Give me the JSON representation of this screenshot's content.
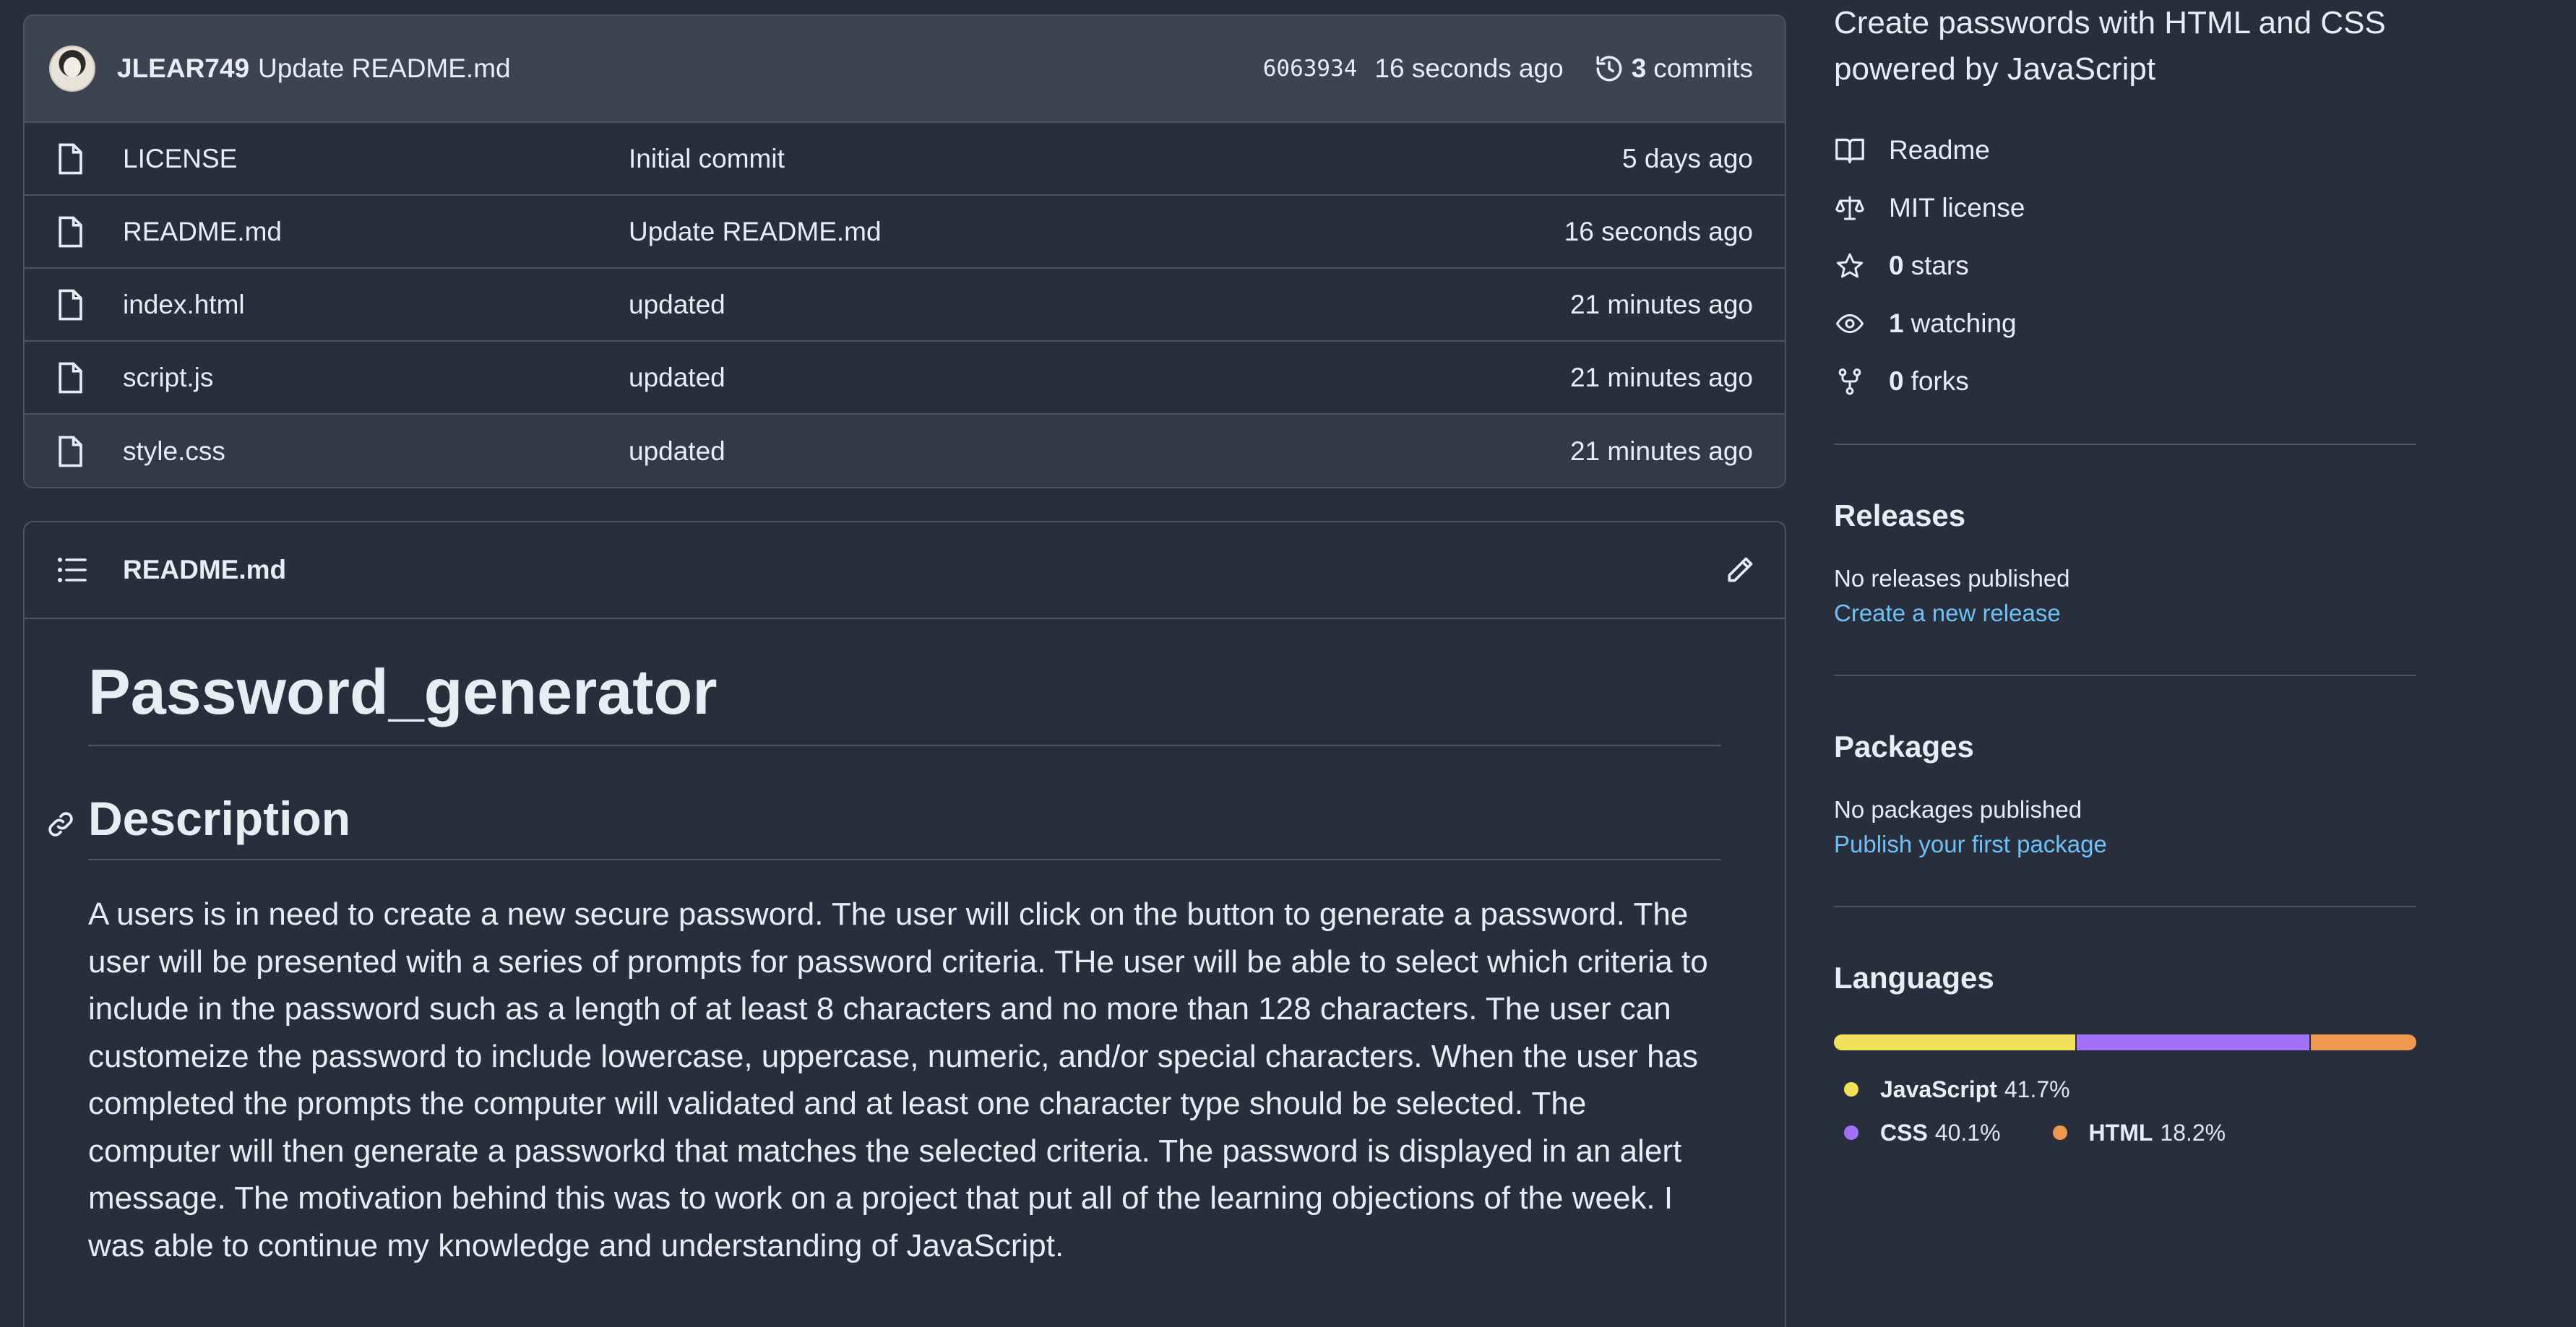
{
  "commit_bar": {
    "author": "JLEAR749",
    "message": "Update README.md",
    "sha": "6063934",
    "time": "16 seconds ago",
    "commits_count": "3",
    "commits_label": "commits"
  },
  "files": [
    {
      "name": "LICENSE",
      "message": "Initial commit",
      "time": "5 days ago"
    },
    {
      "name": "README.md",
      "message": "Update README.md",
      "time": "16 seconds ago"
    },
    {
      "name": "index.html",
      "message": "updated",
      "time": "21 minutes ago"
    },
    {
      "name": "script.js",
      "message": "updated",
      "time": "21 minutes ago"
    },
    {
      "name": "style.css",
      "message": "updated",
      "time": "21 minutes ago"
    }
  ],
  "readme": {
    "filename": "README.md",
    "title": "Password_generator",
    "section_heading": "Description",
    "description": "A users is in need to create a new secure password. The user will click on the button to generate a password. The user will be presented with a series of prompts for password criteria. THe user will be able to select which criteria to include in the password such as a length of at least 8 characters and no more than 128 characters. The user can customeize the password to include lowercase, uppercase, numeric, and/or special characters. When the user has completed the prompts the computer will validated and at least one character type should be selected. The computer will then generate a passworkd that matches the selected criteria. The password is displayed in an alert message. The motivation behind this was to work on a project that put all of the learning objections of the week. I was able to continue my knowledge and understanding of JavaScript."
  },
  "about": {
    "description": "Create passwords with HTML and CSS powered by JavaScript",
    "readme_label": "Readme",
    "license_label": "MIT license",
    "stars_count": "0",
    "stars_label": "stars",
    "watching_count": "1",
    "watching_label": "watching",
    "forks_count": "0",
    "forks_label": "forks"
  },
  "releases": {
    "title": "Releases",
    "status": "No releases published",
    "link": "Create a new release"
  },
  "packages": {
    "title": "Packages",
    "status": "No packages published",
    "link": "Publish your first package"
  },
  "languages": {
    "title": "Languages",
    "items": [
      {
        "name": "JavaScript",
        "percent": "41.7%",
        "value": 41.7,
        "color": "#f1e05a"
      },
      {
        "name": "CSS",
        "percent": "40.1%",
        "value": 40.1,
        "color": "#a371f7"
      },
      {
        "name": "HTML",
        "percent": "18.2%",
        "value": 18.2,
        "color": "#f0984f"
      }
    ]
  },
  "colors": {
    "background": "#282e3b",
    "header_bar": "#3c4452",
    "border": "#4a5263",
    "link": "#6ec1f7"
  }
}
